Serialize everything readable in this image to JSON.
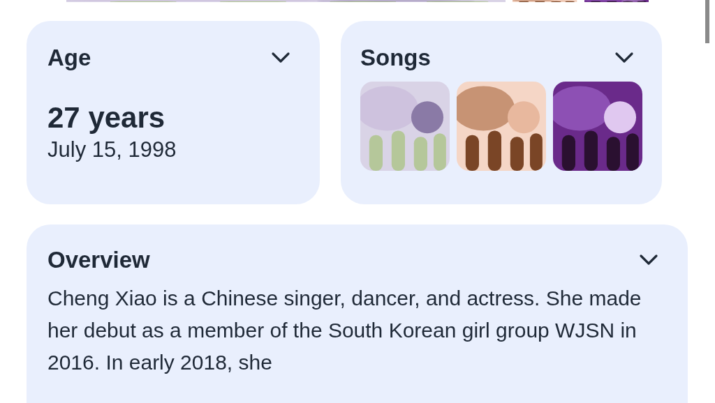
{
  "cards": [
    {
      "kind": "age",
      "title": "Age",
      "value": "27 years",
      "detail": "July 15, 1998"
    },
    {
      "kind": "songs",
      "title": "Songs"
    }
  ],
  "overview": {
    "title": "Overview",
    "text": "Cheng Xiao is a Chinese singer, dancer, and actress. She made her debut as a member of the South Korean girl group WJSN in 2016. In early 2018, she"
  }
}
